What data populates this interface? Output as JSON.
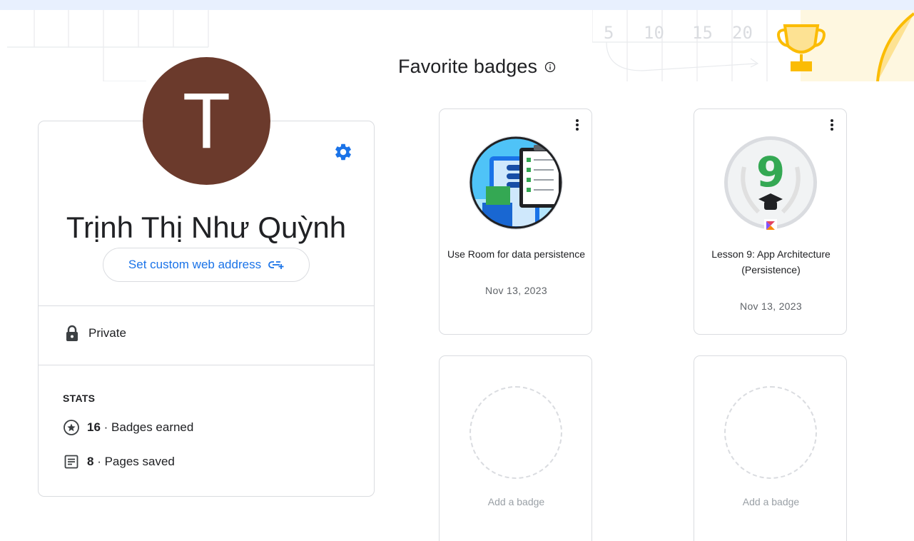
{
  "page": {
    "heading": "Favorite badges",
    "timeline_numbers": [
      "5",
      "10",
      "15",
      "20"
    ]
  },
  "profile": {
    "avatar_initial": "T",
    "name": "Trịnh Thị Như Quỳnh",
    "web_address_button": "Set custom web address",
    "privacy": "Private",
    "stats_heading": "STATS",
    "stats": [
      {
        "count": "16",
        "separator": " · ",
        "label": "Badges earned",
        "icon": "star-circle-icon"
      },
      {
        "count": "8",
        "separator": " · ",
        "label": "Pages saved",
        "icon": "document-icon"
      }
    ]
  },
  "badges": [
    {
      "title": "Use Room for data persistence",
      "date": "Nov 13, 2023",
      "icon": "room-database-badge"
    },
    {
      "title": "Lesson 9: App Architecture (Persistence)",
      "date": "Nov 13, 2023",
      "icon": "lesson-9-badge",
      "number": "9"
    }
  ],
  "empty_slots": [
    {
      "label": "Add a badge"
    },
    {
      "label": "Add a badge"
    }
  ],
  "colors": {
    "accent": "#1a73e8",
    "avatar_bg": "#6b3a2c",
    "border": "#dadce0",
    "trophy": "#fbbc04",
    "badge_green": "#34a853"
  }
}
